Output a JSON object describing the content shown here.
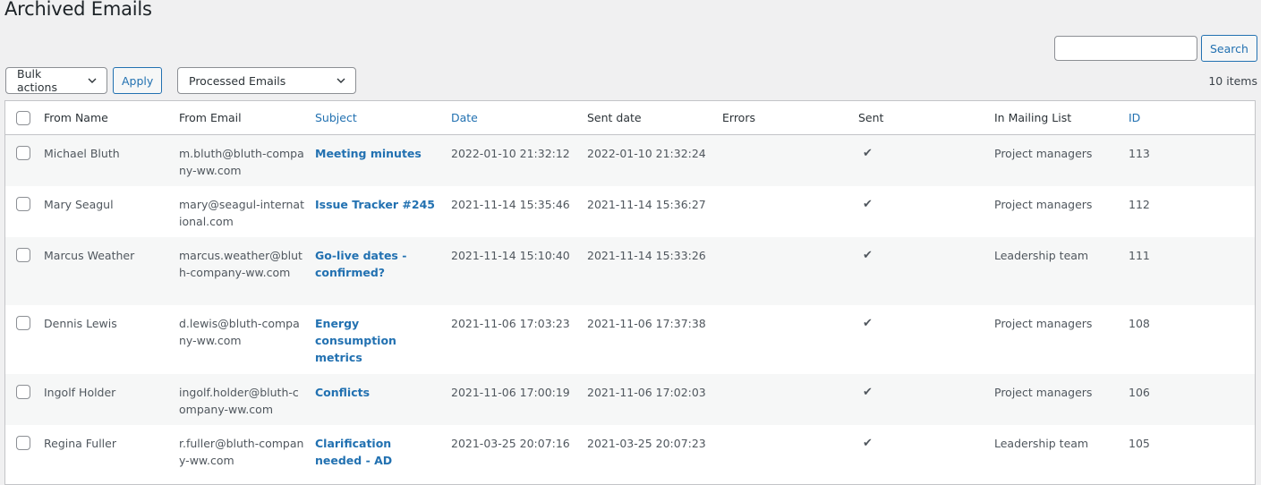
{
  "page": {
    "title": "Archived Emails"
  },
  "search": {
    "value": "",
    "placeholder": "",
    "button_label": "Search"
  },
  "toolbar": {
    "bulk_actions_label": "Bulk actions",
    "apply_label": "Apply",
    "filter_label": "Processed Emails",
    "items_count": "10 items"
  },
  "table": {
    "columns": [
      {
        "label": "From Name",
        "sortable": false
      },
      {
        "label": "From Email",
        "sortable": false
      },
      {
        "label": "Subject",
        "sortable": true
      },
      {
        "label": "Date",
        "sortable": true
      },
      {
        "label": "Sent date",
        "sortable": false
      },
      {
        "label": "Errors",
        "sortable": false
      },
      {
        "label": "Sent",
        "sortable": false
      },
      {
        "label": "In Mailing List",
        "sortable": false
      },
      {
        "label": "ID",
        "sortable": true
      }
    ],
    "sent_icon": "checkmark-icon",
    "rows": [
      {
        "from_name": "Michael Bluth",
        "from_email": "m.bluth@bluth-company-ww.com",
        "subject": "Meeting minutes",
        "date": "2022-01-10 21:32:12",
        "sent_date": "2022-01-10 21:32:24",
        "errors": "",
        "sent": "✔",
        "mailing_list": "Project managers",
        "id": "113"
      },
      {
        "from_name": "Mary Seagul",
        "from_email": "mary@seagul-international.com",
        "subject": "Issue Tracker #245",
        "date": "2021-11-14 15:35:46",
        "sent_date": "2021-11-14 15:36:27",
        "errors": "",
        "sent": "✔",
        "mailing_list": "Project managers",
        "id": "112"
      },
      {
        "from_name": "Marcus Weather",
        "from_email": "marcus.weather@bluth-company-ww.com",
        "subject": "Go-live dates - confirmed?",
        "date": "2021-11-14 15:10:40",
        "sent_date": "2021-11-14 15:33:26",
        "errors": "",
        "sent": "✔",
        "mailing_list": "Leadership team",
        "id": "111"
      },
      {
        "from_name": "Dennis Lewis",
        "from_email": "d.lewis@bluth-company-ww.com",
        "subject": "Energy consumption metrics",
        "date": "2021-11-06 17:03:23",
        "sent_date": "2021-11-06 17:37:38",
        "errors": "",
        "sent": "✔",
        "mailing_list": "Project managers",
        "id": "108"
      },
      {
        "from_name": "Ingolf Holder",
        "from_email": "ingolf.holder@bluth-company-ww.com",
        "subject": "Conflicts",
        "date": "2021-11-06 17:00:19",
        "sent_date": "2021-11-06 17:02:03",
        "errors": "",
        "sent": "✔",
        "mailing_list": "Project managers",
        "id": "106"
      },
      {
        "from_name": "Regina Fuller",
        "from_email": "r.fuller@bluth-company-ww.com",
        "subject": "Clarification needed - AD",
        "date": "2021-03-25 20:07:16",
        "sent_date": "2021-03-25 20:07:23",
        "errors": "",
        "sent": "✔",
        "mailing_list": "Leadership team",
        "id": "105"
      }
    ]
  }
}
